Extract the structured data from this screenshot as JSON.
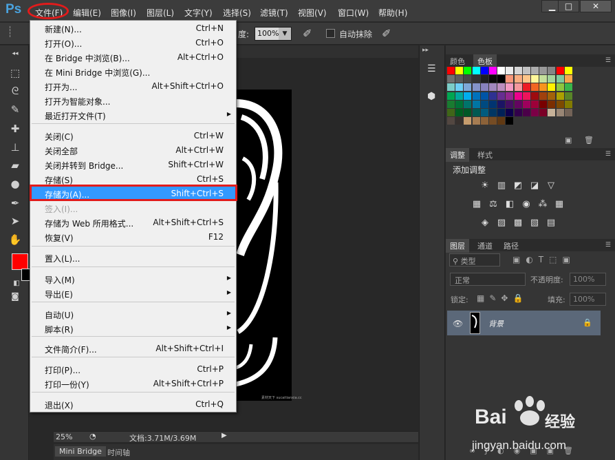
{
  "app": {
    "logo": "Ps"
  },
  "menubar": {
    "items": [
      "文件(F)",
      "编辑(E)",
      "图像(I)",
      "图层(L)",
      "文字(Y)",
      "选择(S)",
      "滤镜(T)",
      "视图(V)",
      "窗口(W)",
      "帮助(H)"
    ],
    "window_buttons": [
      "▁",
      "□",
      "✕"
    ]
  },
  "options": {
    "opacity_label": "度:",
    "opacity_value": "100%",
    "auto_erase_label": "自动抹除"
  },
  "file_menu": {
    "items": [
      {
        "label": "新建(N)...",
        "shortcut": "Ctrl+N"
      },
      {
        "label": "打开(O)...",
        "shortcut": "Ctrl+O"
      },
      {
        "label": "在 Bridge 中浏览(B)...",
        "shortcut": "Alt+Ctrl+O"
      },
      {
        "label": "在 Mini Bridge 中浏览(G)...",
        "shortcut": ""
      },
      {
        "label": "打开为...",
        "shortcut": "Alt+Shift+Ctrl+O"
      },
      {
        "label": "打开为智能对象...",
        "shortcut": ""
      },
      {
        "label": "最近打开文件(T)",
        "shortcut": "",
        "submenu": true
      },
      {
        "label": "关闭(C)",
        "shortcut": "Ctrl+W"
      },
      {
        "label": "关闭全部",
        "shortcut": "Alt+Ctrl+W"
      },
      {
        "label": "关闭并转到 Bridge...",
        "shortcut": "Shift+Ctrl+W"
      },
      {
        "label": "存储(S)",
        "shortcut": "Ctrl+S"
      },
      {
        "label": "存储为(A)...",
        "shortcut": "Shift+Ctrl+S",
        "highlighted": true
      },
      {
        "label": "签入(I)...",
        "shortcut": "",
        "disabled": true
      },
      {
        "label": "存储为 Web 所用格式...",
        "shortcut": "Alt+Shift+Ctrl+S"
      },
      {
        "label": "恢复(V)",
        "shortcut": "F12"
      },
      {
        "label": "置入(L)...",
        "shortcut": ""
      },
      {
        "label": "导入(M)",
        "shortcut": "",
        "submenu": true
      },
      {
        "label": "导出(E)",
        "shortcut": "",
        "submenu": true
      },
      {
        "label": "自动(U)",
        "shortcut": "",
        "submenu": true
      },
      {
        "label": "脚本(R)",
        "shortcut": "",
        "submenu": true
      },
      {
        "label": "文件简介(F)...",
        "shortcut": "Alt+Shift+Ctrl+I"
      },
      {
        "label": "打印(P)...",
        "shortcut": "Ctrl+P"
      },
      {
        "label": "打印一份(Y)",
        "shortcut": "Alt+Shift+Ctrl+P"
      },
      {
        "label": "退出(X)",
        "shortcut": "Ctrl+Q"
      }
    ]
  },
  "status": {
    "zoom": "25%",
    "doc_info": "文档:3.71M/3.69M"
  },
  "bottom_tabs": [
    "Mini Bridge",
    "时间轴"
  ],
  "panels": {
    "swatch_tabs": [
      "颜色",
      "色板"
    ],
    "adjust_tabs": [
      "调整",
      "样式"
    ],
    "adjust_title": "添加调整",
    "layers_tabs": [
      "图层",
      "通道",
      "路径"
    ],
    "kind_label": "类型",
    "blend_mode": "正常",
    "opacity_label": "不透明度:",
    "opacity_value": "100%",
    "lock_label": "锁定:",
    "fill_label": "填充:",
    "fill_value": "100%",
    "layer_name": "背景"
  },
  "canvas": {
    "caption": "素材天下 sucaitianxia.cc"
  },
  "watermark": {
    "brand": "Bai",
    "brand2": "经验",
    "url": "jingyan.baidu.com"
  },
  "colors": {
    "accent_highlight": "#3399ff",
    "annotation_red": "#e21b1b",
    "foreground": "#ff0000",
    "background": "#000000"
  }
}
